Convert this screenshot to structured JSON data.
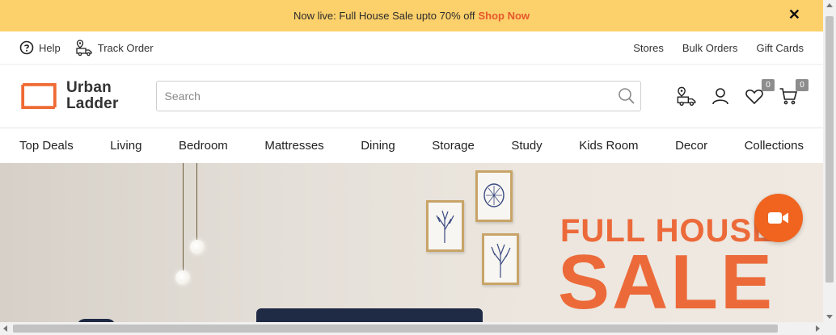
{
  "promo_bar": {
    "text": "Now live: Full House Sale upto 70% off",
    "link_label": "Shop Now",
    "close_label": "✕",
    "background": "#fcd06b",
    "link_color": "#e5582b"
  },
  "utility_bar": {
    "help_label": "Help",
    "track_order_label": "Track Order",
    "links": [
      "Stores",
      "Bulk Orders",
      "Gift Cards"
    ]
  },
  "header": {
    "logo_line1": "Urban",
    "logo_line2": "Ladder",
    "logo_color": "#ef6a34",
    "search_placeholder": "Search",
    "search_value": "",
    "wishlist_count": "0",
    "cart_count": "0"
  },
  "nav": {
    "items": [
      "Top Deals",
      "Living",
      "Bedroom",
      "Mattresses",
      "Dining",
      "Storage",
      "Study",
      "Kids Room",
      "Decor",
      "Collections"
    ]
  },
  "hero": {
    "headline_top": "FULL HOUSE",
    "headline_big": "SALE",
    "headline_color": "#ec6a3a"
  },
  "video_button": {
    "icon": "video-camera-icon",
    "color": "#f0641f"
  }
}
